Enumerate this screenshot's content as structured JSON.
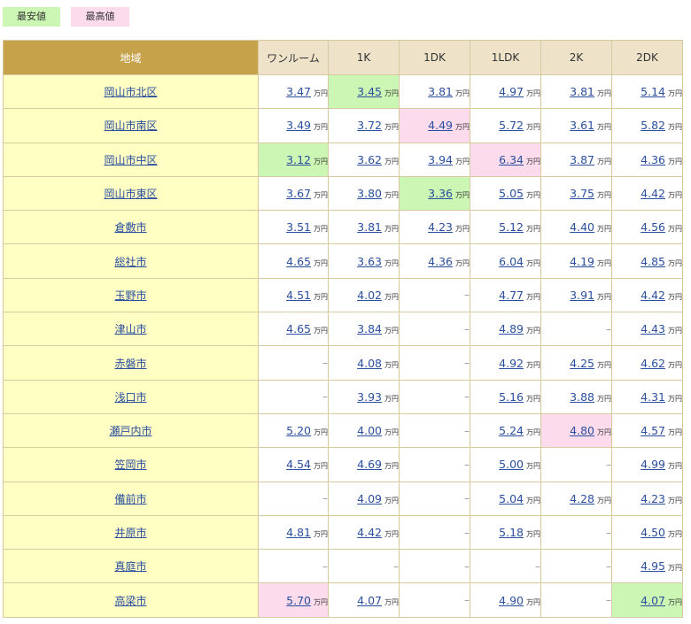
{
  "legend": {
    "min_label": "最安値",
    "max_label": "最高値",
    "min_color": "#ccf6b4",
    "max_color": "#fcdcec"
  },
  "table": {
    "headers": [
      "地域",
      "ワンルーム",
      "1K",
      "1DK",
      "1LDK",
      "2K",
      "2DK"
    ],
    "unit": "万円",
    "dash": "–",
    "rows": [
      {
        "region": "岡山市北区",
        "cells": [
          {
            "v": "3.47"
          },
          {
            "v": "3.45",
            "h": "min"
          },
          {
            "v": "3.81"
          },
          {
            "v": "4.97"
          },
          {
            "v": "3.81"
          },
          {
            "v": "5.14"
          }
        ]
      },
      {
        "region": "岡山市南区",
        "cells": [
          {
            "v": "3.49"
          },
          {
            "v": "3.72"
          },
          {
            "v": "4.49",
            "h": "max"
          },
          {
            "v": "5.72"
          },
          {
            "v": "3.61"
          },
          {
            "v": "5.82"
          }
        ]
      },
      {
        "region": "岡山市中区",
        "cells": [
          {
            "v": "3.12",
            "h": "min"
          },
          {
            "v": "3.62"
          },
          {
            "v": "3.94"
          },
          {
            "v": "6.34",
            "h": "max"
          },
          {
            "v": "3.87"
          },
          {
            "v": "4.36"
          }
        ]
      },
      {
        "region": "岡山市東区",
        "cells": [
          {
            "v": "3.67"
          },
          {
            "v": "3.80"
          },
          {
            "v": "3.36",
            "h": "min"
          },
          {
            "v": "5.05"
          },
          {
            "v": "3.75"
          },
          {
            "v": "4.42"
          }
        ]
      },
      {
        "region": "倉敷市",
        "cells": [
          {
            "v": "3.51"
          },
          {
            "v": "3.81"
          },
          {
            "v": "4.23"
          },
          {
            "v": "5.12"
          },
          {
            "v": "4.40"
          },
          {
            "v": "4.56"
          }
        ]
      },
      {
        "region": "総社市",
        "cells": [
          {
            "v": "4.65"
          },
          {
            "v": "3.63"
          },
          {
            "v": "4.36"
          },
          {
            "v": "6.04"
          },
          {
            "v": "4.19"
          },
          {
            "v": "4.85"
          }
        ]
      },
      {
        "region": "玉野市",
        "cells": [
          {
            "v": "4.51"
          },
          {
            "v": "4.02"
          },
          {
            "v": null
          },
          {
            "v": "4.77"
          },
          {
            "v": "3.91"
          },
          {
            "v": "4.42"
          }
        ]
      },
      {
        "region": "津山市",
        "cells": [
          {
            "v": "4.65"
          },
          {
            "v": "3.84"
          },
          {
            "v": null
          },
          {
            "v": "4.89"
          },
          {
            "v": null
          },
          {
            "v": "4.43"
          }
        ]
      },
      {
        "region": "赤磐市",
        "cells": [
          {
            "v": null
          },
          {
            "v": "4.08"
          },
          {
            "v": null
          },
          {
            "v": "4.92"
          },
          {
            "v": "4.25"
          },
          {
            "v": "4.62"
          }
        ]
      },
      {
        "region": "浅口市",
        "cells": [
          {
            "v": null
          },
          {
            "v": "3.93"
          },
          {
            "v": null
          },
          {
            "v": "5.16"
          },
          {
            "v": "3.88"
          },
          {
            "v": "4.31"
          }
        ]
      },
      {
        "region": "瀬戸内市",
        "cells": [
          {
            "v": "5.20"
          },
          {
            "v": "4.00"
          },
          {
            "v": null
          },
          {
            "v": "5.24"
          },
          {
            "v": "4.80",
            "h": "max"
          },
          {
            "v": "4.57"
          }
        ]
      },
      {
        "region": "笠岡市",
        "cells": [
          {
            "v": "4.54"
          },
          {
            "v": "4.69"
          },
          {
            "v": null
          },
          {
            "v": "5.00"
          },
          {
            "v": null
          },
          {
            "v": "4.99"
          }
        ]
      },
      {
        "region": "備前市",
        "cells": [
          {
            "v": null
          },
          {
            "v": "4.09"
          },
          {
            "v": null
          },
          {
            "v": "5.04"
          },
          {
            "v": "4.28"
          },
          {
            "v": "4.23"
          }
        ]
      },
      {
        "region": "井原市",
        "cells": [
          {
            "v": "4.81"
          },
          {
            "v": "4.42"
          },
          {
            "v": null
          },
          {
            "v": "5.18"
          },
          {
            "v": null
          },
          {
            "v": "4.50"
          }
        ]
      },
      {
        "region": "真庭市",
        "cells": [
          {
            "v": null
          },
          {
            "v": null
          },
          {
            "v": null
          },
          {
            "v": null
          },
          {
            "v": null
          },
          {
            "v": "4.95"
          }
        ]
      },
      {
        "region": "高梁市",
        "cells": [
          {
            "v": "5.70",
            "h": "max"
          },
          {
            "v": "4.07"
          },
          {
            "v": null
          },
          {
            "v": "4.90"
          },
          {
            "v": null
          },
          {
            "v": "4.07",
            "h": "min"
          }
        ]
      }
    ]
  }
}
